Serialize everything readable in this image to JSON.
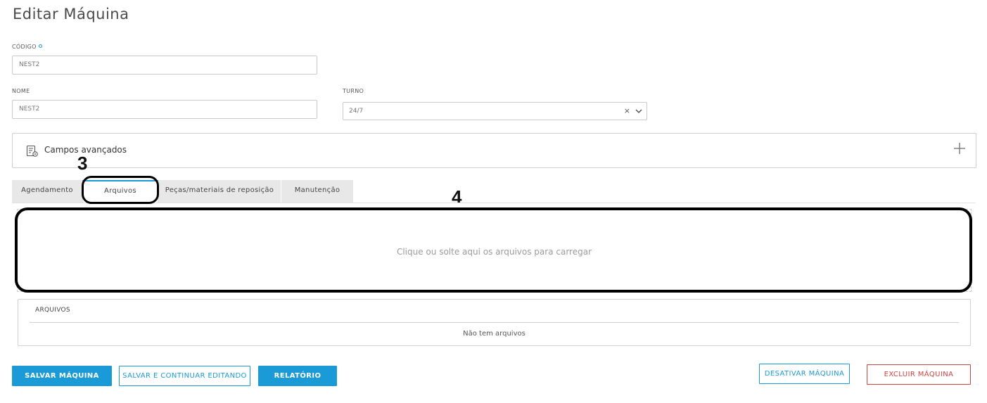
{
  "page": {
    "title": "Editar Máquina"
  },
  "form": {
    "codigo": {
      "label": "CÓDIGO",
      "value": "NEST2"
    },
    "nome": {
      "label": "NOME",
      "value": "NEST2"
    },
    "turno": {
      "label": "TURNO",
      "value": "24/7",
      "clear": "×"
    }
  },
  "advanced": {
    "label": "Campos avançados",
    "icon": "settings-list-icon",
    "expand_icon": "plus-icon"
  },
  "annotations": {
    "tab_marker": "3",
    "dropzone_marker": "4"
  },
  "tabs": [
    {
      "label": "Agendamento",
      "active": false
    },
    {
      "label": "Arquivos",
      "active": true
    },
    {
      "label": "Peças/materiais de reposição",
      "active": false
    },
    {
      "label": "Manutenção",
      "active": false
    }
  ],
  "dropzone": {
    "text": "Clique ou solte aqui os arquivos para carregar"
  },
  "files": {
    "header": "ARQUIVOS",
    "empty_text": "Não tem arquivos"
  },
  "buttons": {
    "save": "SALVAR MÁQUINA",
    "save_continue": "SALVAR E CONTINUAR EDITANDO",
    "report": "RELATÓRIO",
    "deactivate": "DESATIVAR MÁQUINA",
    "delete": "EXCLUIR MÁQUINA"
  },
  "colors": {
    "accent": "#1a9ad6",
    "danger": "#d0443f"
  }
}
